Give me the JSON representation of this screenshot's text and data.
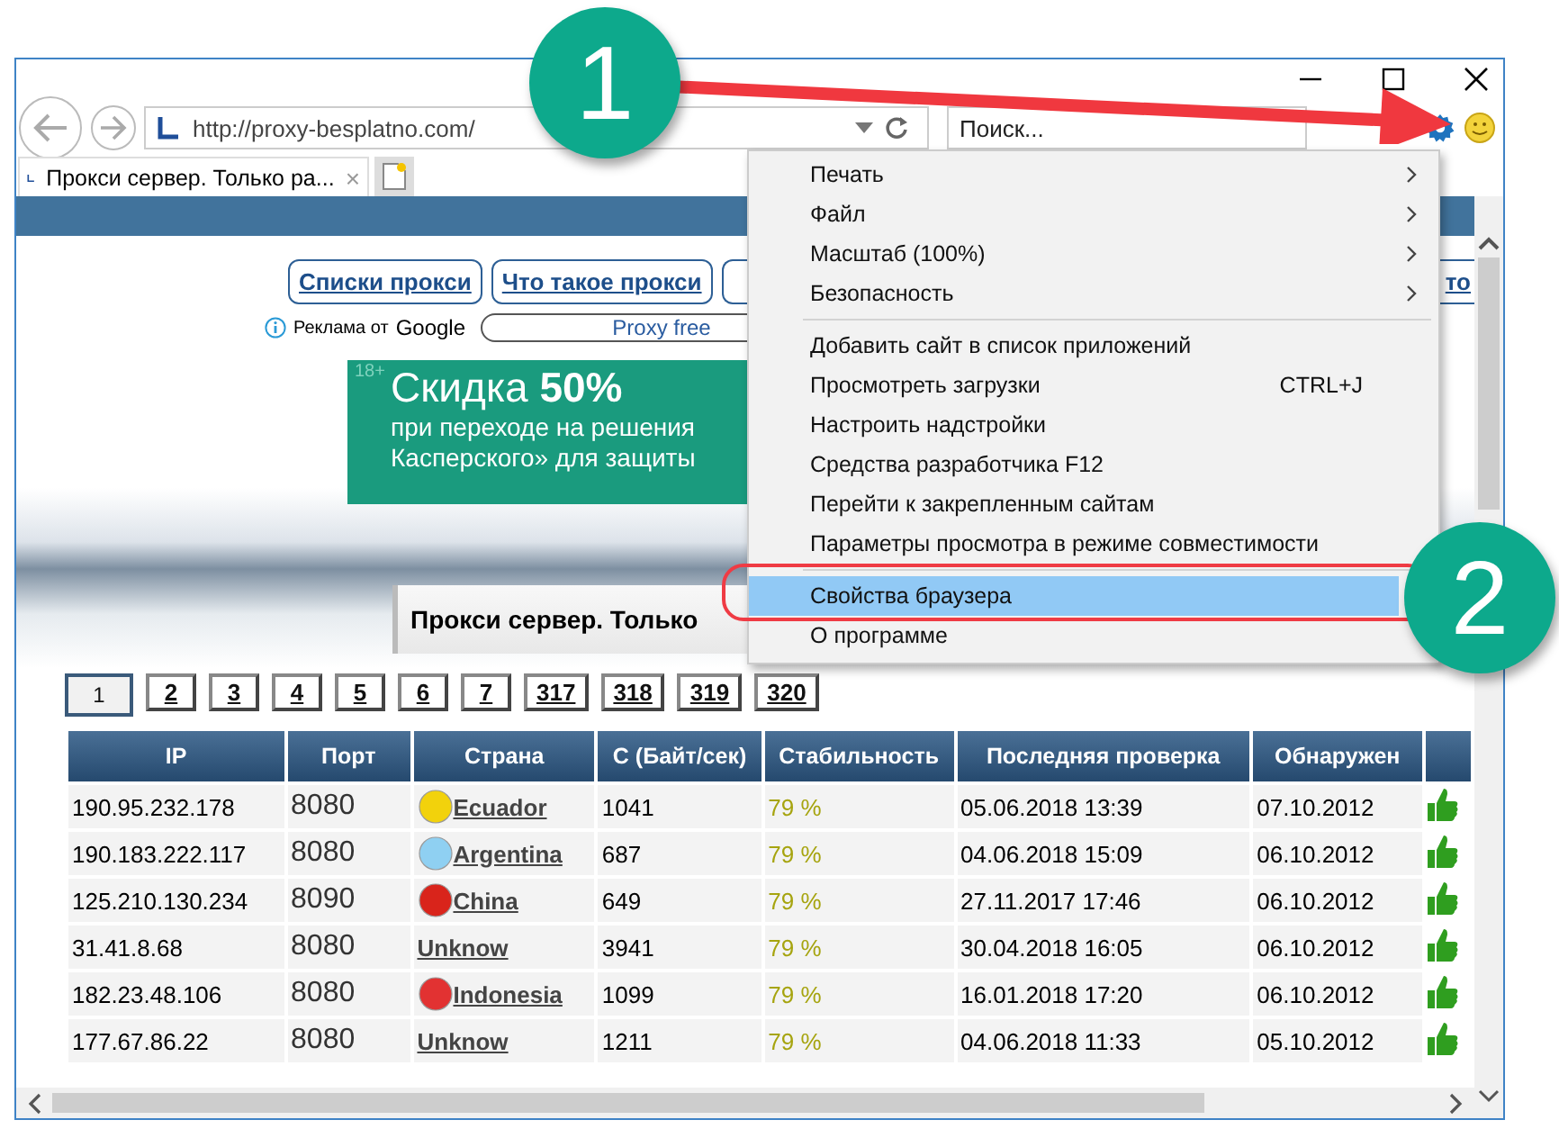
{
  "browser": {
    "address": "http://proxy-besplatno.com/",
    "search": {
      "placeholder": "Поиск..."
    },
    "tabs": [
      {
        "title": "Прокси сервер. Только ра...",
        "close": "×"
      }
    ]
  },
  "page": {
    "nav_links": [
      {
        "label": "Списки прокси"
      },
      {
        "label": "Что такое прокси"
      },
      {
        "label": "то"
      }
    ],
    "ad_label": "Реклама от",
    "ad_brand": "Google",
    "ad_field": "Proxy free",
    "banner": {
      "age": "18+",
      "headline": "Скидка **50%**",
      "line_1": "при переходе на решения",
      "line_2": "Касперского» для защиты"
    },
    "heading": "Прокси сервер. Только",
    "pages": [
      {
        "label": "1",
        "selected": true
      },
      {
        "label": "2",
        "selected": false
      },
      {
        "label": "3",
        "selected": false
      },
      {
        "label": "4",
        "selected": false
      },
      {
        "label": "5",
        "selected": false
      },
      {
        "label": "6",
        "selected": false
      },
      {
        "label": "7",
        "selected": false
      },
      {
        "label": "317",
        "selected": false
      },
      {
        "label": "318",
        "selected": false
      },
      {
        "label": "319",
        "selected": false
      },
      {
        "label": "320",
        "selected": false
      }
    ],
    "table": {
      "columns": [
        "IP",
        "Порт",
        "Страна",
        "С (Байт/сек)",
        "Стабильность",
        "Последняя проверка",
        "Обнаружен"
      ],
      "rows": [
        {
          "ip": "190.95.232.178",
          "port": "8080",
          "country": "Ecuador",
          "color": "#f2d20c",
          "speed": "1041",
          "stability": "79 %",
          "last_check": "05.06.2018 13:39",
          "found": "07.10.2012"
        },
        {
          "ip": "190.183.222.117",
          "port": "8080",
          "country": "Argentina",
          "color": "#8fd0f2",
          "speed": "687",
          "stability": "79 %",
          "last_check": "04.06.2018 15:09",
          "found": "06.10.2012"
        },
        {
          "ip": "125.210.130.234",
          "port": "8090",
          "country": "China",
          "color": "#d9241b",
          "speed": "649",
          "stability": "79 %",
          "last_check": "27.11.2017 17:46",
          "found": "06.10.2012"
        },
        {
          "ip": "31.41.8.68",
          "port": "8080",
          "country": "Unknow",
          "speed": "3941",
          "stability": "79 %",
          "last_check": "30.04.2018 16:05",
          "found": "06.10.2012"
        },
        {
          "ip": "182.23.48.106",
          "port": "8080",
          "country": "Indonesia",
          "color": "#e23232",
          "speed": "1099",
          "stability": "79 %",
          "last_check": "16.01.2018 17:20",
          "found": "06.10.2012"
        },
        {
          "ip": "177.67.86.22",
          "port": "8080",
          "country": "Unknow",
          "speed": "1211",
          "stability": "79 %",
          "last_check": "04.06.2018 11:33",
          "found": "05.10.2012"
        }
      ]
    }
  },
  "menu": {
    "items": [
      {
        "kind": "submenu",
        "label": "Печать",
        "selected": false
      },
      {
        "kind": "submenu",
        "label": "Файл",
        "selected": false
      },
      {
        "kind": "submenu",
        "label": "Масштаб (100%)",
        "selected": false
      },
      {
        "kind": "submenu",
        "label": "Безопасность",
        "selected": false
      },
      {
        "kind": "separator"
      },
      {
        "kind": "item",
        "label": "Добавить сайт в список приложений",
        "selected": false
      },
      {
        "kind": "item",
        "label": "Просмотреть загрузки",
        "shortcut": "CTRL+J",
        "selected": false
      },
      {
        "kind": "item",
        "label": "Настроить надстройки",
        "selected": false
      },
      {
        "kind": "item",
        "label": "Средства разработчика F12",
        "selected": false
      },
      {
        "kind": "item",
        "label": "Перейти к закрепленным сайтам",
        "selected": false
      },
      {
        "kind": "item",
        "label": "Параметры просмотра в режиме совместимости",
        "selected": false
      },
      {
        "kind": "separator"
      },
      {
        "kind": "item",
        "label": "Свойства браузера",
        "selected": true
      },
      {
        "kind": "item",
        "label": "О программе",
        "selected": false
      }
    ]
  },
  "callouts": [
    {
      "label": "1"
    },
    {
      "label": "2"
    }
  ]
}
